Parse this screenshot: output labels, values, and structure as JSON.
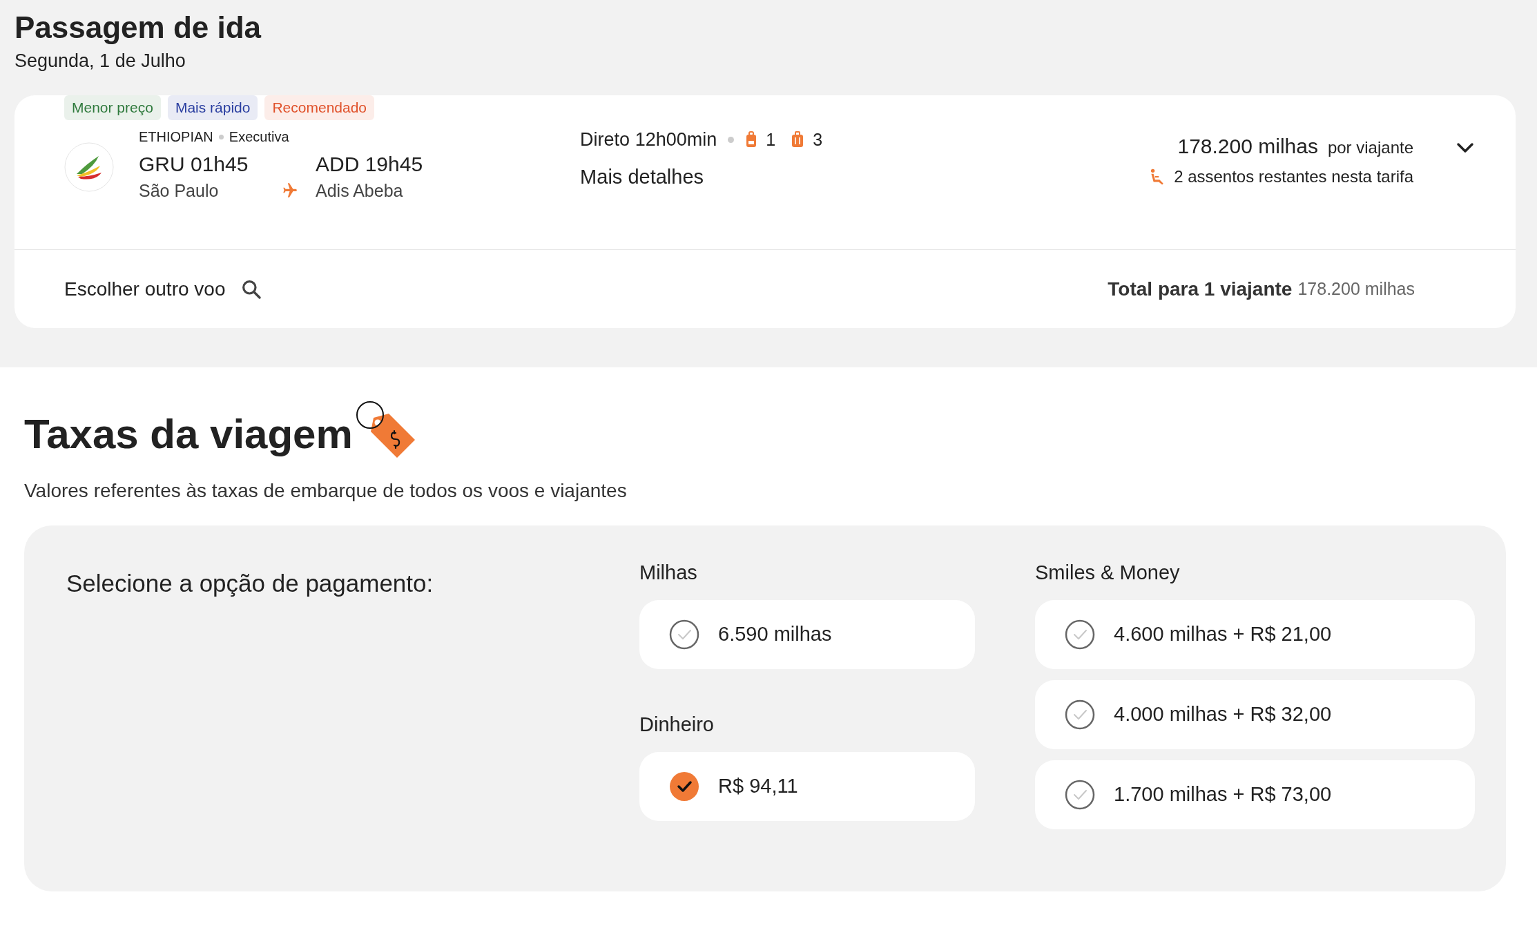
{
  "header": {
    "title": "Passagem de ida",
    "subtitle": "Segunda, 1 de Julho"
  },
  "flight_card": {
    "badges": [
      {
        "label": "Menor preço",
        "color": "#2f7a3d"
      },
      {
        "label": "Mais rápido",
        "color": "#2a3ea0"
      },
      {
        "label": "Recomendado",
        "color": "#e0512a"
      }
    ],
    "airline": "ETHIOPIAN",
    "cabin": "Executiva",
    "departure": {
      "code_time": "GRU 01h45",
      "city": "São Paulo"
    },
    "arrival": {
      "code_time": "ADD 19h45",
      "city": "Adis Abeba"
    },
    "duration": "Direto 12h00min",
    "carry_on": "1",
    "checked_bags": "3",
    "details_link": "Mais detalhes",
    "price": "178.200 milhas",
    "price_unit": "por viajante",
    "seats_left": "2 assentos restantes nesta tarifa",
    "expanded": false,
    "choose_other": "Escolher outro voo",
    "total_label": "Total para 1 viajante",
    "total_value": "178.200 milhas"
  },
  "fees": {
    "title": "Taxas da viagem",
    "description": "Valores referentes às taxas de embarque de todos os voos e viajantes",
    "payment_label": "Selecione a opção de pagamento:",
    "columns": [
      [
        {
          "title": "Milhas",
          "options": [
            {
              "label": "6.590 milhas",
              "selected": false
            }
          ]
        },
        {
          "title": "Dinheiro",
          "options": [
            {
              "label": "R$ 94,11",
              "selected": true
            }
          ]
        }
      ],
      [
        {
          "title": "Smiles & Money",
          "options": [
            {
              "label": "4.600 milhas + R$ 21,00",
              "selected": false
            },
            {
              "label": "4.000 milhas + R$ 32,00",
              "selected": false
            },
            {
              "label": "1.700 milhas + R$ 73,00",
              "selected": false
            }
          ]
        }
      ]
    ]
  }
}
